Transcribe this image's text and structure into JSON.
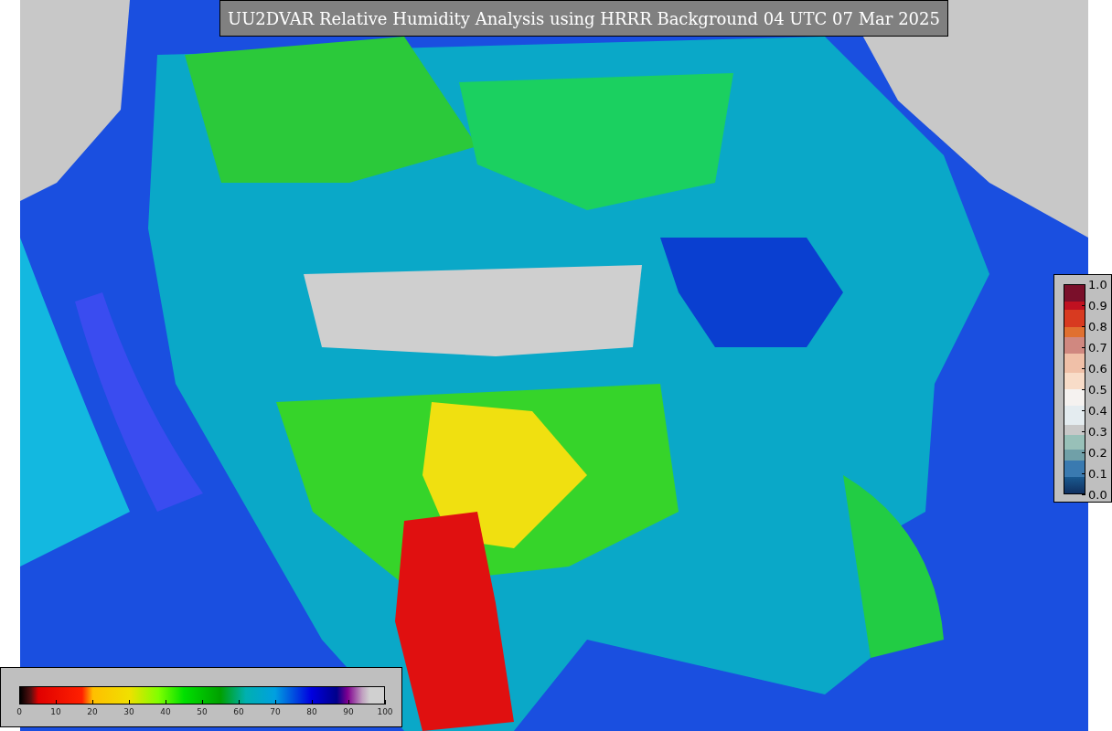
{
  "title": "UU2DVAR Relative Humidity Analysis using HRRR Background 04 UTC 07 Mar 2025",
  "humidity_colorbar": {
    "ticks": [
      "0",
      "10",
      "20",
      "30",
      "40",
      "50",
      "60",
      "70",
      "80",
      "90",
      "100"
    ]
  },
  "side_colorbar": {
    "ticks": [
      "1.0",
      "0.9",
      "0.8",
      "0.7",
      "0.6",
      "0.5",
      "0.4",
      "0.3",
      "0.2",
      "0.1",
      "0.0"
    ]
  }
}
